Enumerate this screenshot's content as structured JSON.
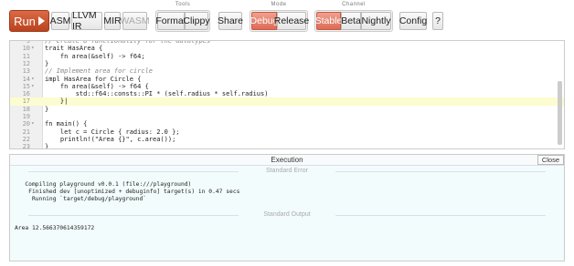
{
  "toolbar": {
    "run_label": "Run",
    "views": [
      "ASM",
      "LLVM IR",
      "MIR",
      "WASM"
    ],
    "tools_label": "Tools",
    "tools": [
      "Format",
      "Clippy"
    ],
    "share_label": "Share",
    "mode_label": "Mode",
    "modes": [
      "Debug",
      "Release"
    ],
    "active_mode": "Debug",
    "channel_label": "Channel",
    "channels": [
      "Stable",
      "Beta",
      "Nightly"
    ],
    "active_channel": "Stable",
    "config_label": "Config",
    "help_label": "?"
  },
  "editor": {
    "lines": [
      {
        "n": "9",
        "text": "// Create a functionality for the datatypes",
        "type": "comment"
      },
      {
        "n": "10",
        "fold": "▾",
        "text": "trait HasArea {",
        "type": "code"
      },
      {
        "n": "11",
        "text": "    fn area(&self) -> f64;",
        "type": "code"
      },
      {
        "n": "12",
        "text": "}",
        "type": "code"
      },
      {
        "n": "13",
        "text": "// Implement area for circle",
        "type": "comment"
      },
      {
        "n": "14",
        "fold": "▾",
        "text": "impl HasArea for Circle {",
        "type": "code"
      },
      {
        "n": "15",
        "fold": "▾",
        "text": "    fn area(&self) -> f64 {",
        "type": "code"
      },
      {
        "n": "16",
        "text": "        std::f64::consts::PI * (self.radius * self.radius)",
        "type": "code"
      },
      {
        "n": "17",
        "text": "    }|",
        "type": "code",
        "active": true
      },
      {
        "n": "18",
        "text": "}",
        "type": "code"
      },
      {
        "n": "19",
        "text": "",
        "type": "code"
      },
      {
        "n": "20",
        "fold": "▾",
        "text": "fn main() {",
        "type": "code"
      },
      {
        "n": "21",
        "text": "    let c = Circle { radius: 2.0 };",
        "type": "code"
      },
      {
        "n": "22",
        "text": "    println!(\"Area {}\", c.area());",
        "type": "code"
      },
      {
        "n": "23",
        "text": "}",
        "type": "code"
      }
    ]
  },
  "output": {
    "title": "Execution",
    "close_label": "Close",
    "stderr_label": "Standard Error",
    "stderr_lines": [
      "   Compiling playground v0.0.1 (file:///playground)",
      "    Finished dev [unoptimized + debuginfo] target(s) in 0.47 secs",
      "     Running `target/debug/playground`"
    ],
    "stdout_label": "Standard Output",
    "stdout_lines": [
      "Area 12.566370614359172"
    ]
  }
}
